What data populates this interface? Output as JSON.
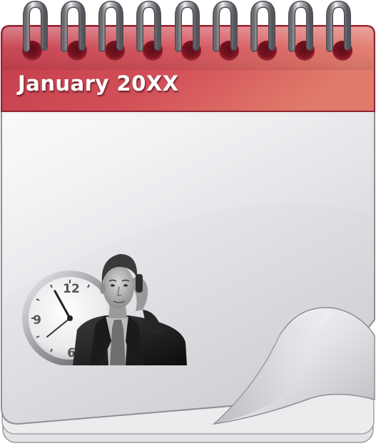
{
  "calendar": {
    "month_title": "January 20XX",
    "ring_count": 9,
    "header_color": "#cc4a55"
  },
  "illustration": {
    "description_icon": "man-on-phone-with-clock",
    "clock_numerals": {
      "twelve": "12",
      "nine": "9",
      "six": "6"
    }
  }
}
